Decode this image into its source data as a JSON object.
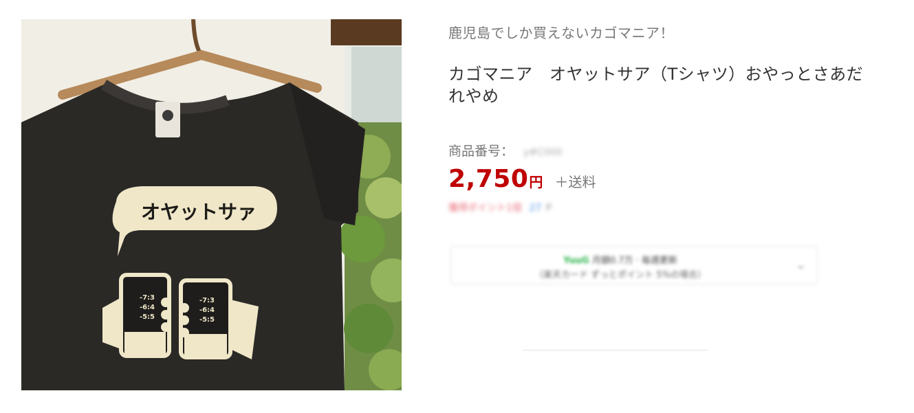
{
  "product": {
    "image": {
      "alt": "オヤットサア Tシャツ",
      "print_text": "オヤットサァ",
      "mug_left_lines": [
        "-7:3",
        "-6:4",
        "-5:5"
      ],
      "mug_right_lines": [
        "-7:3",
        "-6:4",
        "-5:5"
      ],
      "shirt_color": "#2b2926"
    },
    "tagline": "鹿児島でしか買えないカゴマニア！",
    "title": "カゴマニア　オヤットサア（Tシャツ）おやっとさあだれやめ",
    "code_label": "商品番号：",
    "code_value": "y#C000",
    "price_amount": "2,750",
    "price_unit": "円",
    "shipping": "＋送料",
    "points": {
      "red_text": "獲得ポイント1倍",
      "blue_text": "27",
      "gray_text": "P"
    },
    "payment": {
      "green_text": "YuuG",
      "line1_text": "月額0.7万 · 毎週更新",
      "line2_text": "（楽天カード ずっとポイント 5%の場合）"
    }
  },
  "colors": {
    "price": "#bf0000",
    "tagline": "#777777",
    "title": "#333333"
  }
}
